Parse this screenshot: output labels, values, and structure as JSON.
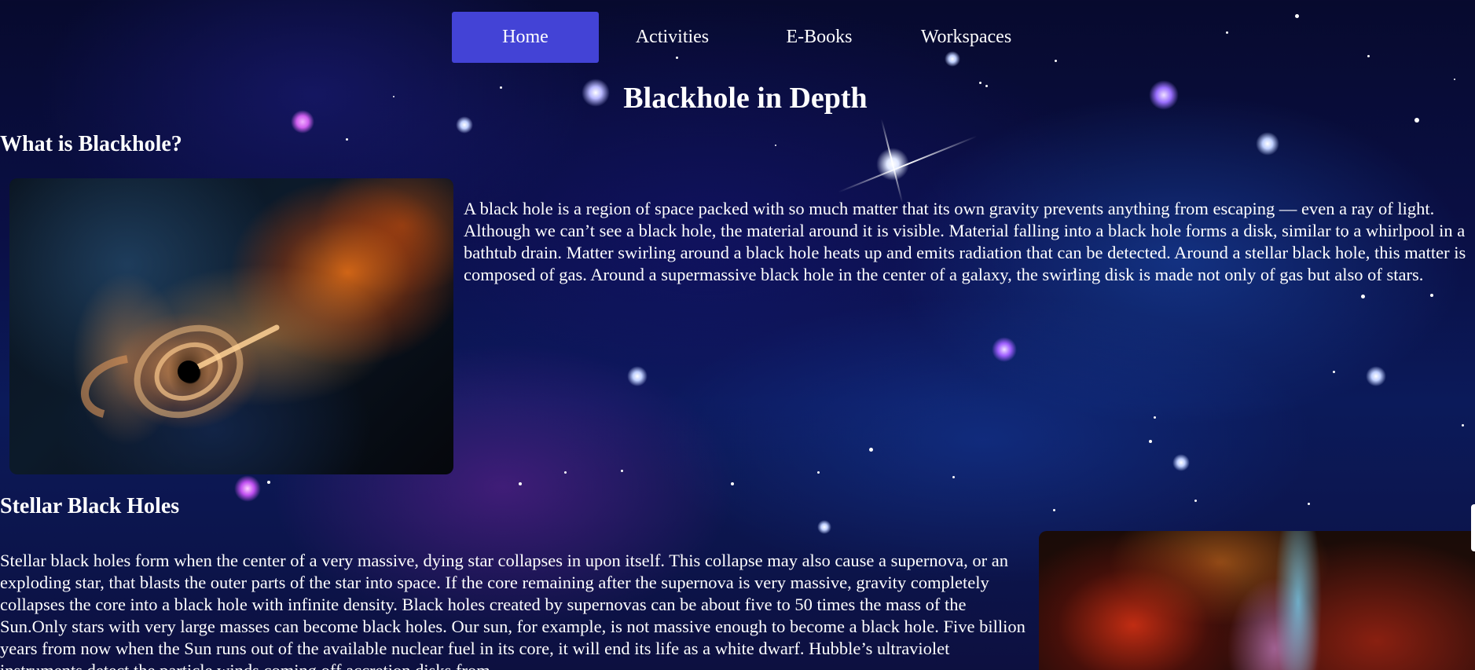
{
  "nav": {
    "items": [
      {
        "label": "Home",
        "active": true
      },
      {
        "label": "Activities",
        "active": false
      },
      {
        "label": "E-Books",
        "active": false
      },
      {
        "label": "Workspaces",
        "active": false
      }
    ]
  },
  "page": {
    "title": "Blackhole in Depth"
  },
  "sections": [
    {
      "heading": "What is Blackhole?",
      "text": "A black hole is a region of space packed with so much matter that its own gravity prevents anything from escaping — even a ray of light. Although we can’t see a black hole, the material around it is visible. Material falling into a black hole forms a disk, similar to a whirlpool in a bathtub drain. Matter swirling around a black hole heats up and emits radiation that can be detected. Around a stellar black hole, this matter is composed of gas. Around a supermassive black hole in the center of a galaxy, the swirling disk is made not only of gas but also of stars."
    },
    {
      "heading": "Stellar Black Holes",
      "text": "Stellar black holes form when the center of a very massive, dying star collapses in upon itself. This collapse may also cause a supernova, or an exploding star, that blasts the outer parts of the star into space. If the core remaining after the supernova is very massive, gravity completely collapses the core into a black hole with infinite density. Black holes created by supernovas can be about five to 50 times the mass of the Sun.Only stars with very large masses can become black holes. Our sun, for example, is not massive enough to become a black hole. Five billion years from now when the Sun runs out of the available nuclear fuel in its core, it will end its life as a white dwarf. Hubble’s ultraviolet instruments detect the particle winds coming off accretion disks from"
    }
  ],
  "colors": {
    "nav_active": "#4343d6",
    "text": "#ffffff",
    "background": "#0a0f45"
  }
}
